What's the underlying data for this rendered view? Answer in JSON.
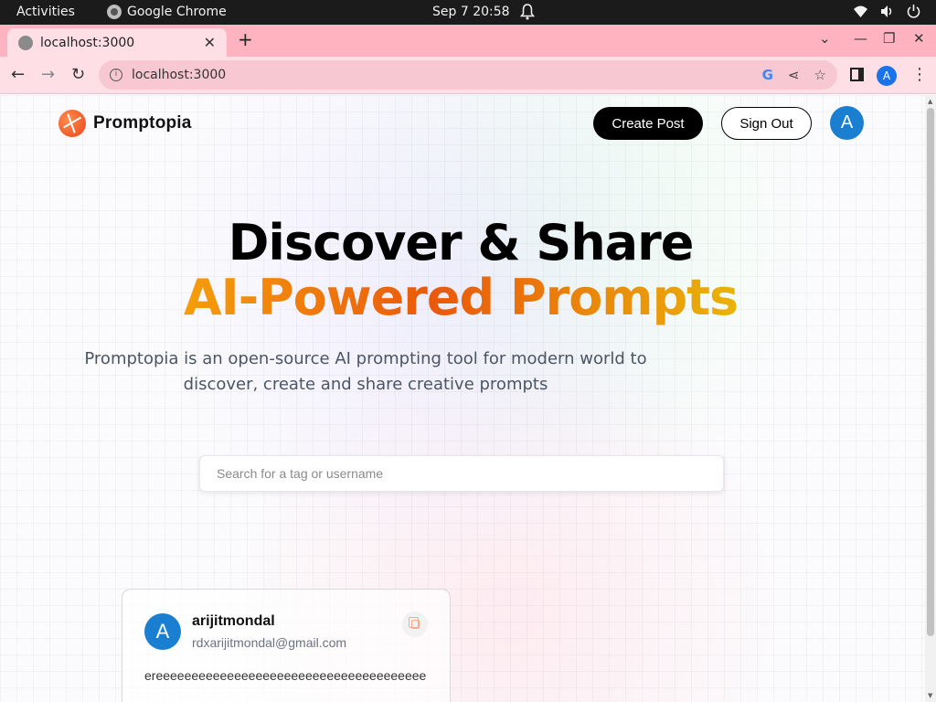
{
  "system_bar": {
    "activities": "Activities",
    "app_name": "Google Chrome",
    "clock": "Sep 7  20:58"
  },
  "browser": {
    "tab_title": "localhost:3000",
    "url": "localhost:3000",
    "profile_initial": "A"
  },
  "page": {
    "brand": "Promptopia",
    "create_post": "Create Post",
    "sign_out": "Sign Out",
    "avatar_initial": "A",
    "hero_line1": "Discover & Share",
    "hero_line2": "AI-Powered Prompts",
    "description": "Promptopia is an open-source AI prompting tool for modern world to discover, create and share creative prompts",
    "search_placeholder": "Search for a tag or username",
    "card": {
      "avatar_initial": "A",
      "username": "arijitmondal",
      "email": "rdxarijitmondal@gmail.com",
      "prompt": "ereeeeeeeeeeeeeeeeeeeeeeeeeeeeeeeeeeeeee"
    }
  },
  "colors": {
    "accent_gradient": [
      "#f59e0b",
      "#ea580c",
      "#eab308"
    ],
    "avatar_blue": "#1a7fd1",
    "tab_strip": "#ffb3c1"
  }
}
